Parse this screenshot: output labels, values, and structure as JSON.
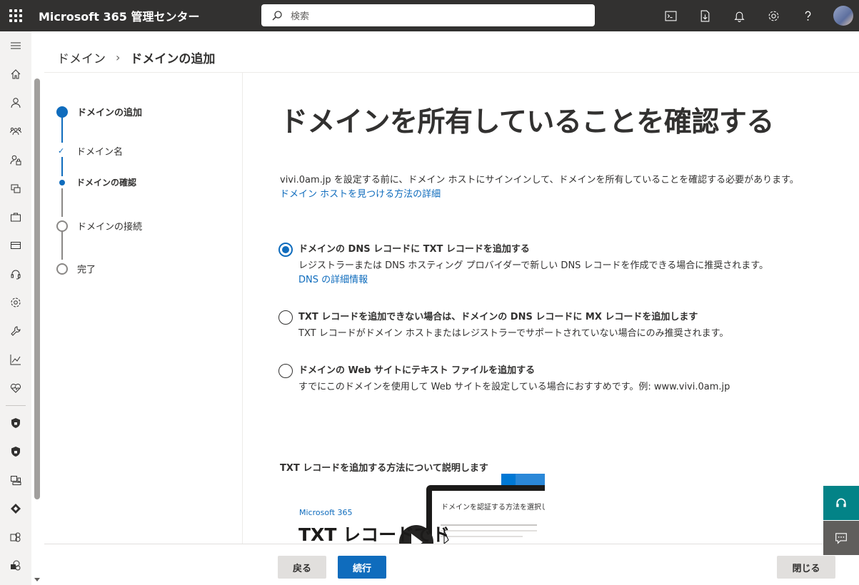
{
  "app": {
    "title": "Microsoft 365 管理センター"
  },
  "search": {
    "placeholder": "検索"
  },
  "topbar_icons": [
    "terminal-icon",
    "document-download-icon",
    "bell-icon",
    "gear-icon",
    "help-icon",
    "avatar"
  ],
  "rail_icons": [
    "home-icon",
    "user-icon",
    "group-icon",
    "user-lock-icon",
    "devices-icon",
    "briefcase-icon",
    "billing-icon",
    "headset-icon",
    "settings-icon",
    "wrench-icon",
    "chart-icon",
    "health-icon",
    "shield-icon",
    "shield-icon",
    "admin-centers-icon",
    "azure-icon",
    "exchange-icon",
    "sharepoint-icon"
  ],
  "breadcrumb": {
    "parent": "ドメイン",
    "current": "ドメインの追加"
  },
  "stepper": {
    "steps": [
      {
        "label": "ドメインの追加",
        "state": "current"
      },
      {
        "label": "ドメイン名",
        "state": "done"
      },
      {
        "label": "ドメインの確認",
        "state": "current-sub"
      },
      {
        "label": "ドメインの接続",
        "state": "pending"
      },
      {
        "label": "完了",
        "state": "pending"
      }
    ]
  },
  "main": {
    "title": "ドメインを所有していることを確認する",
    "intro": "vivi.0am.jp を設定する前に、ドメイン ホストにサインインして、ドメインを所有していることを確認する必要があります。",
    "intro_link": "ドメイン ホストを見つける方法の詳細",
    "options": [
      {
        "title": "ドメインの DNS レコードに TXT レコードを追加する",
        "desc": "レジストラーまたは DNS ホスティング プロバイダーで新しい DNS レコードを作成できる場合に推奨されます。",
        "link": "DNS の詳細情報",
        "checked": true
      },
      {
        "title": "TXT レコードを追加できない場合は、ドメインの DNS レコードに MX レコードを追加します",
        "desc": "TXT レコードがドメイン ホストまたはレジストラーでサポートされていない場合にのみ推奨されます。",
        "link": "",
        "checked": false
      },
      {
        "title": "ドメインの Web サイトにテキスト ファイルを追加する",
        "desc": "すでにこのドメインを使用して Web サイトを設定している場合におすすめです。例: www.vivi.0am.jp",
        "link": "",
        "checked": false
      }
    ],
    "video_heading": "TXT レコードを追加する方法について説明します",
    "video": {
      "brand": "Microsoft 365",
      "headline": "TXT レコードでド",
      "screen_title": "ドメインを認証する方法を選択してく"
    }
  },
  "footer": {
    "back": "戻る",
    "next": "続行",
    "close": "閉じる"
  },
  "colors": {
    "accent": "#0f6cbd",
    "topbar": "#323130",
    "help": "#038387"
  }
}
